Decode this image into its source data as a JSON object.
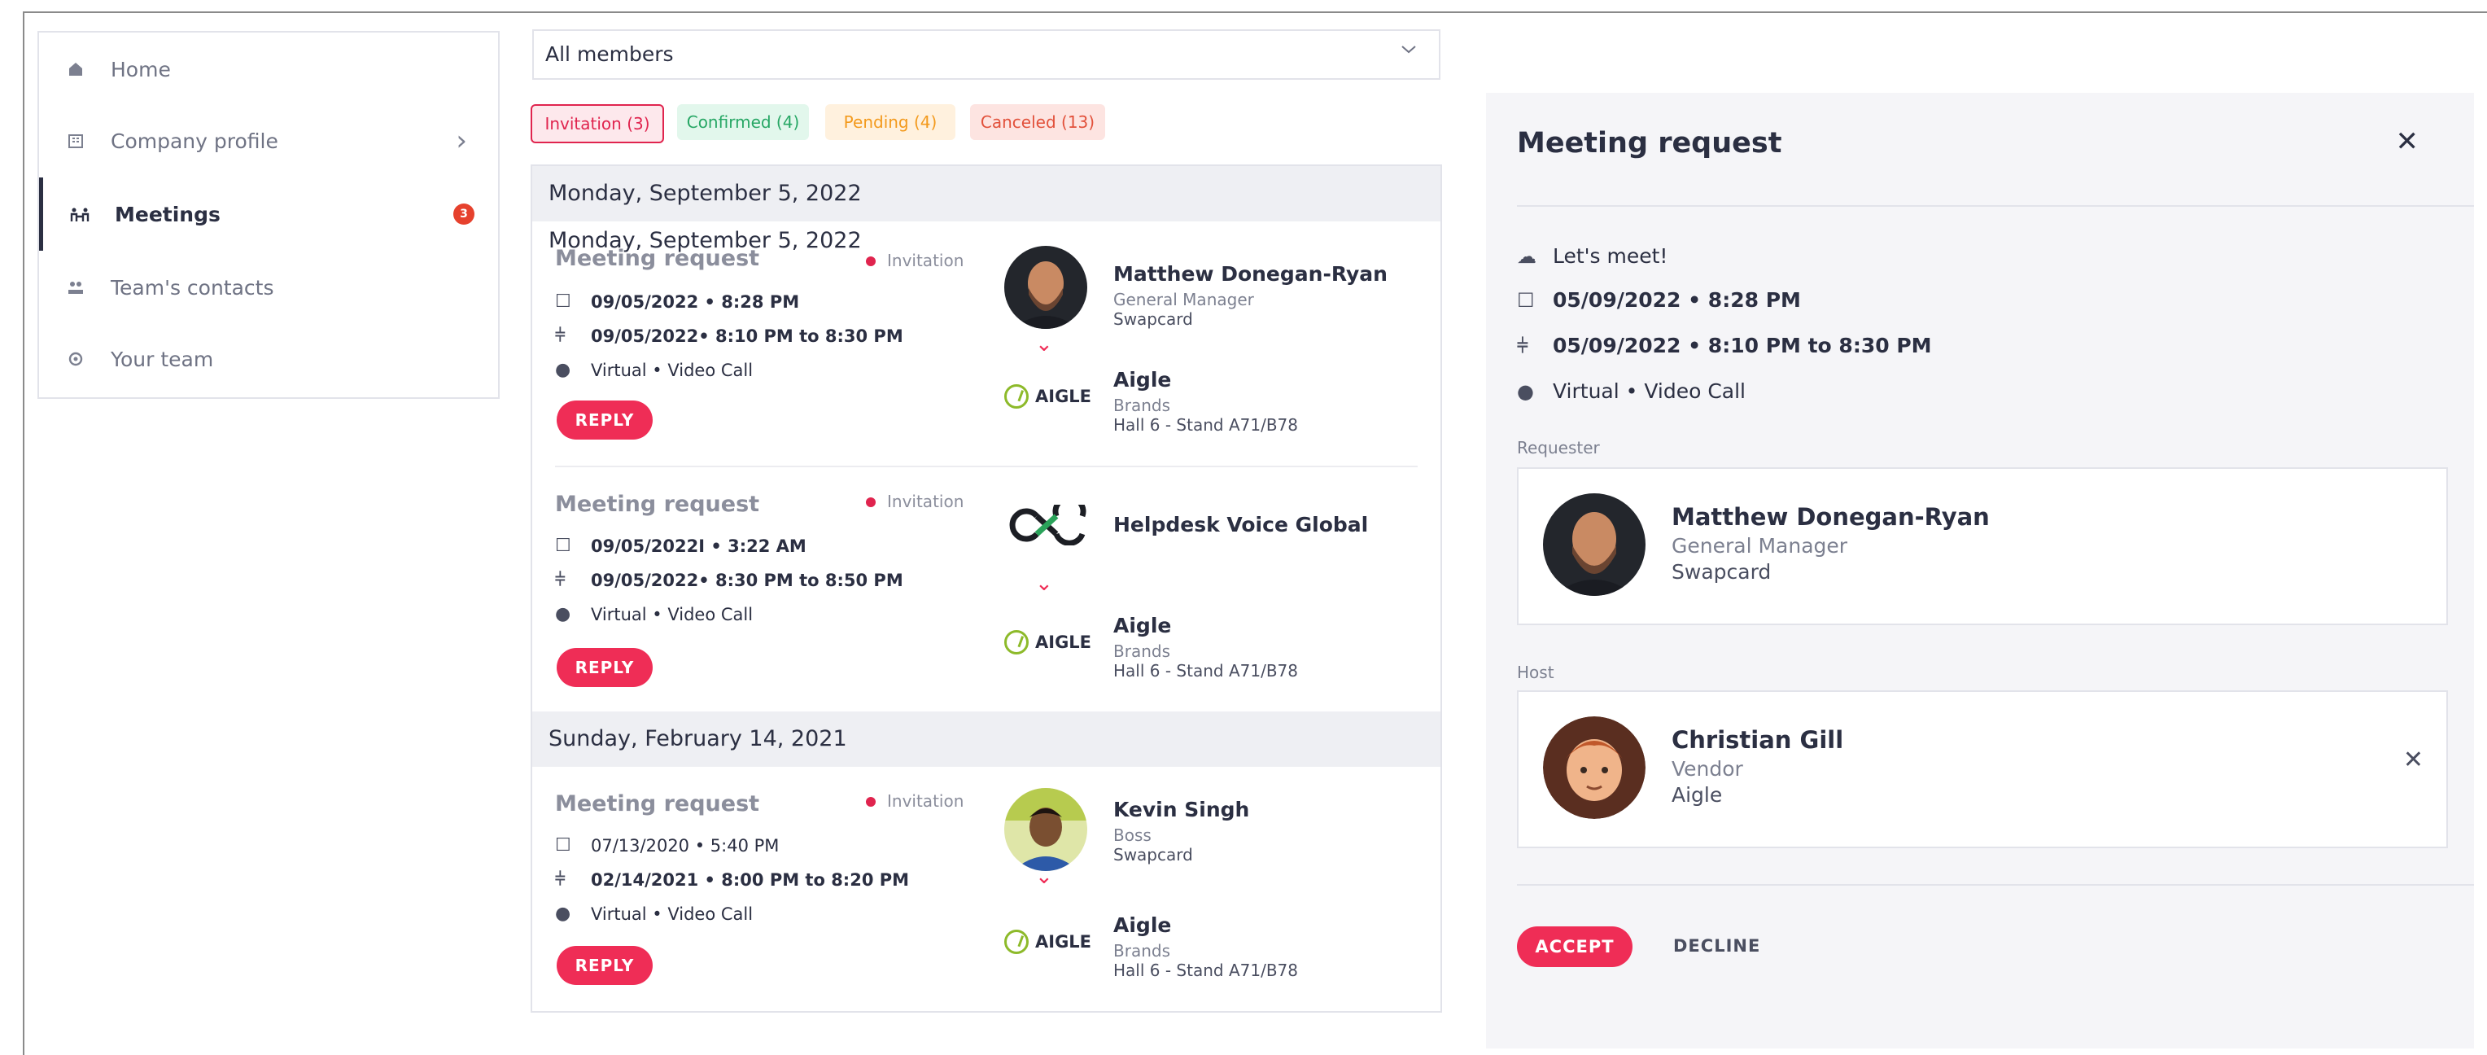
{
  "sidebar": {
    "items": [
      {
        "label": "Home",
        "icon": "home-icon"
      },
      {
        "label": "Company profile",
        "icon": "building-icon"
      },
      {
        "label": "Meetings",
        "icon": "meetings-icon",
        "badge": "3"
      },
      {
        "label": "Team's contacts",
        "icon": "contacts-icon"
      },
      {
        "label": "Your team",
        "icon": "gear-icon"
      }
    ]
  },
  "filter": {
    "value": "All members"
  },
  "chips": {
    "invitation": "Invitation (3)",
    "confirmed": "Confirmed (4)",
    "pending": "Pending (4)",
    "canceled": "Canceled (13)"
  },
  "list": {
    "day1": "Monday, September 5, 2022",
    "day1_overlap": "Monday, September 5, 2022",
    "day2": "Sunday, February 14, 2021",
    "cards": [
      {
        "title": "Meeting request",
        "status": "Invitation",
        "created": "09/05/2022 • 8:28 PM",
        "slot": "09/05/2022• 8:10 PM to 8:30 PM",
        "location": "Virtual • Video Call",
        "reply": "REPLY",
        "person": {
          "name": "Matthew Donegan-Ryan",
          "role": "General Manager",
          "company": "Swapcard"
        },
        "org": {
          "logo": "AIGLE",
          "name": "Aigle",
          "type": "Brands",
          "hall": "Hall 6 - Stand A71/B78"
        }
      },
      {
        "title": "Meeting request",
        "status": "Invitation",
        "created": "09/05/2022I • 3:22 AM",
        "slot": "09/05/2022• 8:30 PM to 8:50 PM",
        "location": "Virtual • Video Call",
        "reply": "REPLY",
        "person": {
          "name": "Helpdesk Voice Global"
        },
        "org": {
          "logo": "AIGLE",
          "name": "Aigle",
          "type": "Brands",
          "hall": "Hall 6 - Stand A71/B78"
        }
      },
      {
        "title": "Meeting request",
        "status": "Invitation",
        "created": "07/13/2020 • 5:40 PM",
        "slot": "02/14/2021 • 8:00 PM to 8:20 PM",
        "location": "Virtual • Video Call",
        "reply": "REPLY",
        "person": {
          "name": "Kevin Singh",
          "role": "Boss",
          "company": "Swapcard"
        },
        "org": {
          "logo": "AIGLE",
          "name": "Aigle",
          "type": "Brands",
          "hall": "Hall 6 - Stand A71/B78"
        }
      }
    ]
  },
  "panel": {
    "title": "Meeting request",
    "message": "Let's meet!",
    "created": "05/09/2022  • 8:28 PM",
    "slot": "05/09/2022 • 8:10 PM to 8:30 PM",
    "location": "Virtual • Video Call",
    "requester_label": "Requester",
    "requester": {
      "name": "Matthew Donegan-Ryan",
      "role": "General Manager",
      "company": "Swapcard"
    },
    "host_label": "Host",
    "host": {
      "name": "Christian Gill",
      "role": "Vendor",
      "company": "Aigle"
    },
    "accept": "ACCEPT",
    "decline": "DECLINE"
  },
  "colors": {
    "accent": "#ef2d56",
    "badge": "#e6412d",
    "text": "#2b2f42"
  }
}
